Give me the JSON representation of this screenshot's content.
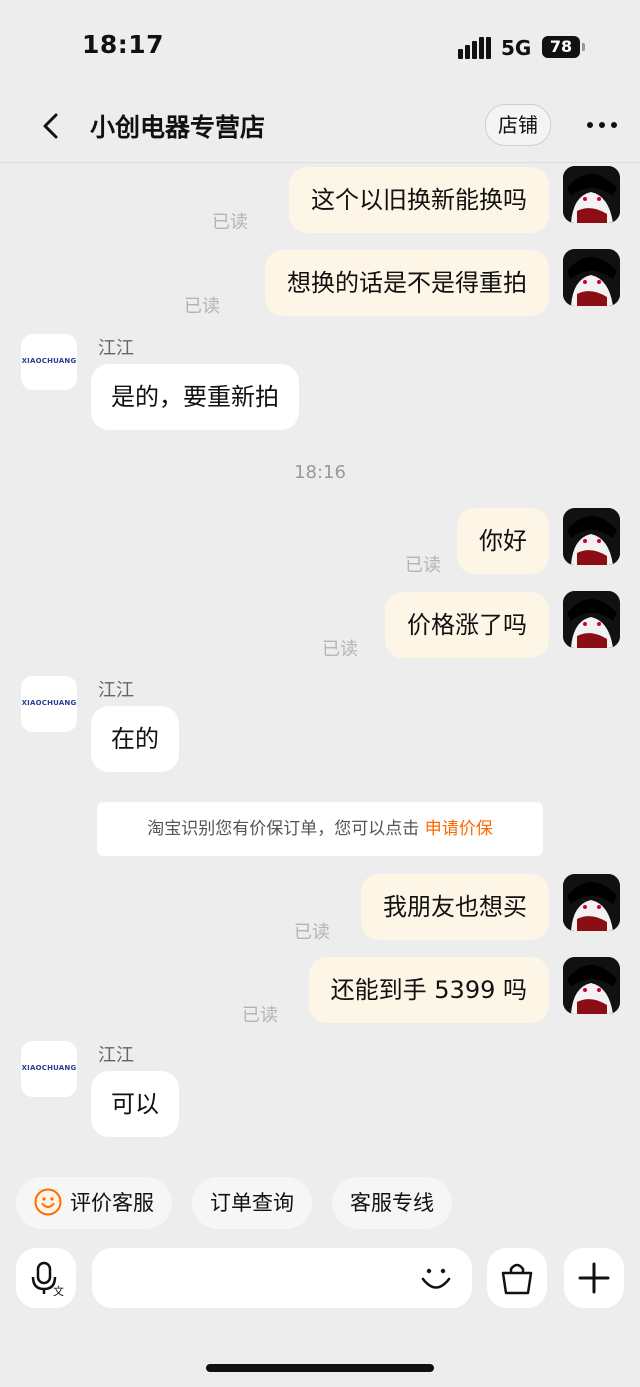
{
  "status_bar": {
    "time": "18:17",
    "network": "5G",
    "battery": "78"
  },
  "header": {
    "title": "小创电器专营店",
    "shop_button": "店铺"
  },
  "read_label": "已读",
  "shop_logo_text": "XIAOCHUANG",
  "messages": [
    {
      "text": "这个以旧换新能换吗"
    },
    {
      "text": "想换的话是不是得重拍"
    },
    {
      "sender": "江江",
      "text": "是的，要重新拍"
    },
    {
      "text": "你好"
    },
    {
      "text": "价格涨了吗"
    },
    {
      "sender": "江江",
      "text": "在的"
    },
    {
      "text": "我朋友也想买"
    },
    {
      "text": "还能到手 5399 吗"
    },
    {
      "sender": "江江",
      "text": "可以"
    }
  ],
  "timestamp": "18:16",
  "notice": {
    "text": "淘宝识别您有价保订单，您可以点击 ",
    "link": "申请价保"
  },
  "quick_replies": [
    "评价客服",
    "订单查询",
    "客服专线"
  ]
}
